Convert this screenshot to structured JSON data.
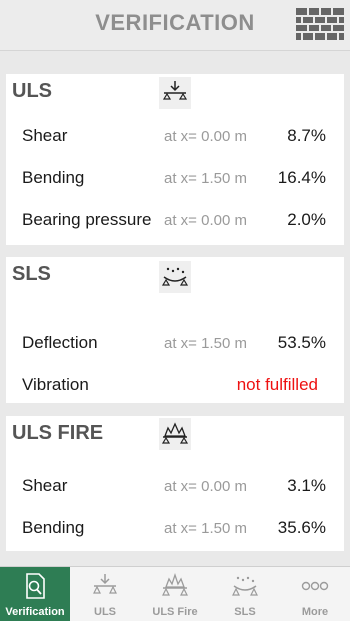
{
  "header": {
    "title": "VERIFICATION"
  },
  "uls": {
    "title": "ULS",
    "rows": [
      {
        "label": "Shear",
        "position": "at x= 0.00 m",
        "value": "8.7%"
      },
      {
        "label": "Bending",
        "position": "at x= 1.50 m",
        "value": "16.4%"
      },
      {
        "label": "Bearing pressure",
        "position": "at x= 0.00 m",
        "value": "2.0%"
      }
    ]
  },
  "sls": {
    "title": "SLS",
    "rows": [
      {
        "label": "Deflection",
        "position": "at x= 1.50 m",
        "value": "53.5%"
      },
      {
        "label": "Vibration",
        "value": "not fulfilled"
      }
    ]
  },
  "uls_fire": {
    "title": "ULS FIRE",
    "rows": [
      {
        "label": "Shear",
        "position": "at x= 0.00 m",
        "value": "3.1%"
      },
      {
        "label": "Bending",
        "position": "at x= 1.50 m",
        "value": "35.6%"
      }
    ]
  },
  "tabs": [
    {
      "label": "Verification",
      "icon": "magnifier-document-icon",
      "active": true
    },
    {
      "label": "ULS",
      "icon": "uls-beam-icon",
      "active": false
    },
    {
      "label": "ULS Fire",
      "icon": "fire-beam-icon",
      "active": false
    },
    {
      "label": "SLS",
      "icon": "sls-beam-icon",
      "active": false
    },
    {
      "label": "More",
      "icon": "more-dots-icon",
      "active": false
    }
  ],
  "colors": {
    "active_tab": "#2e7d54",
    "fail_text": "#ee1111",
    "header_text": "#8e8e8e"
  }
}
